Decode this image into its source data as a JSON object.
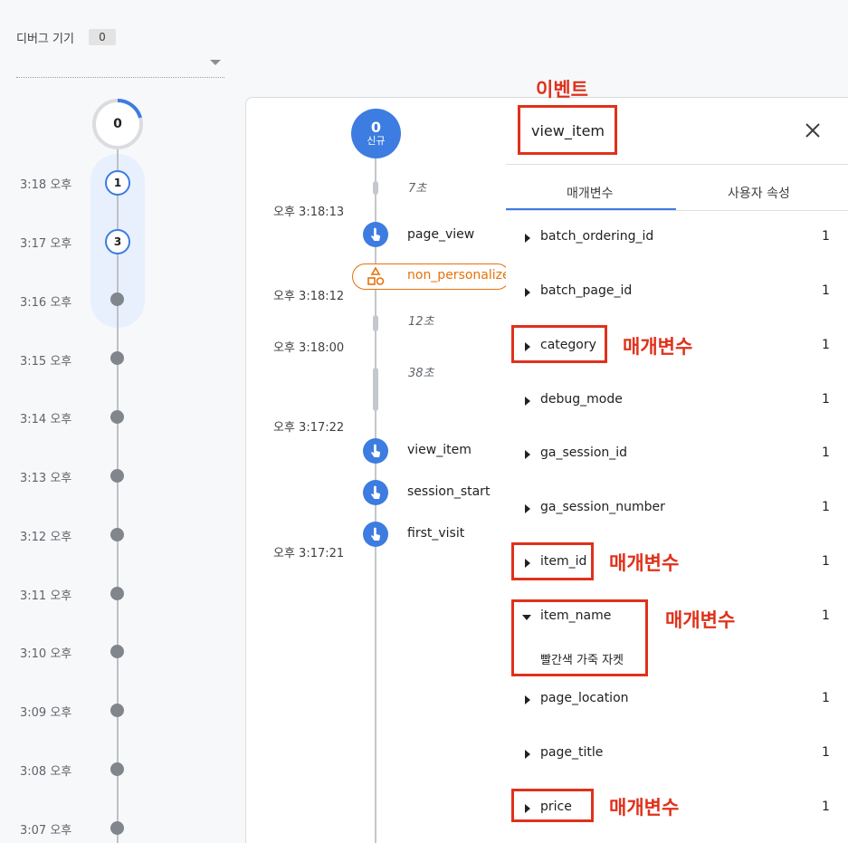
{
  "device": {
    "label": "디버그 기기",
    "count": "0"
  },
  "minutes": {
    "top_count": "0",
    "rows": [
      {
        "time": "3:18 오후",
        "badge": "1"
      },
      {
        "time": "3:17 오후",
        "badge": "3"
      },
      {
        "time": "3:16 오후",
        "badge": ""
      },
      {
        "time": "3:15 오후",
        "badge": ""
      },
      {
        "time": "3:14 오후",
        "badge": ""
      },
      {
        "time": "3:13 오후",
        "badge": ""
      },
      {
        "time": "3:12 오후",
        "badge": ""
      },
      {
        "time": "3:11 오후",
        "badge": ""
      },
      {
        "time": "3:10 오후",
        "badge": ""
      },
      {
        "time": "3:09 오후",
        "badge": ""
      },
      {
        "time": "3:08 오후",
        "badge": ""
      },
      {
        "time": "3:07 오후",
        "badge": ""
      }
    ]
  },
  "stream": {
    "user_count": "0",
    "user_label": "신규",
    "gaps": [
      "7초",
      "12초",
      "38초"
    ],
    "timestamps": [
      "오후 3:18:13",
      "오후 3:18:12",
      "오후 3:18:00",
      "오후 3:17:22",
      "오후 3:17:21"
    ],
    "events": [
      "page_view",
      "non_personalize",
      "view_item",
      "session_start",
      "first_visit"
    ]
  },
  "panel": {
    "title": "view_item",
    "tabs": [
      "매개변수",
      "사용자 속성"
    ],
    "params": [
      {
        "name": "batch_ordering_id",
        "count": "1"
      },
      {
        "name": "batch_page_id",
        "count": "1"
      },
      {
        "name": "category",
        "count": "1"
      },
      {
        "name": "debug_mode",
        "count": "1"
      },
      {
        "name": "ga_session_id",
        "count": "1"
      },
      {
        "name": "ga_session_number",
        "count": "1"
      },
      {
        "name": "item_id",
        "count": "1"
      },
      {
        "name": "item_name",
        "count": "1",
        "value": "빨간색 가죽 자켓"
      },
      {
        "name": "page_location",
        "count": "1"
      },
      {
        "name": "page_title",
        "count": "1"
      },
      {
        "name": "price",
        "count": "1"
      }
    ]
  },
  "annotations": {
    "event": "이벤트",
    "category": "매개변수",
    "item_id": "매개변수",
    "item_name": "매개변수",
    "price": "매개변수"
  },
  "colors": {
    "accent": "#3d7ce0",
    "annotation": "#e0311b",
    "consent": "#e8710a"
  }
}
